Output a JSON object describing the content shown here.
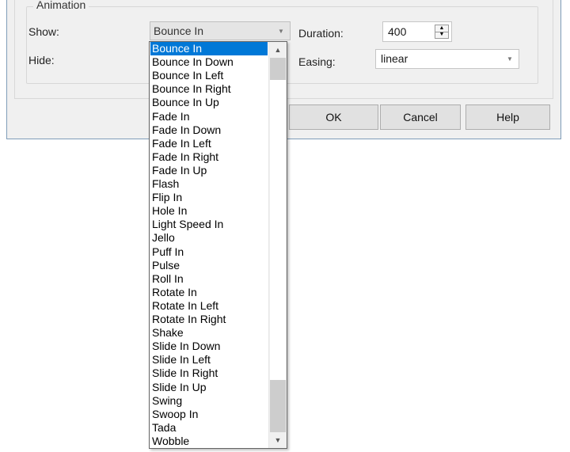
{
  "animation": {
    "group_title": "Animation",
    "show_label": "Show:",
    "hide_label": "Hide:",
    "duration_label": "Duration:",
    "easing_label": "Easing:",
    "show_value": "Bounce In",
    "duration_value": "400",
    "easing_value": "linear"
  },
  "buttons": {
    "ok": "OK",
    "cancel": "Cancel",
    "help": "Help"
  },
  "dropdown": {
    "selected": "Bounce In",
    "options": [
      "Bounce In",
      "Bounce In Down",
      "Bounce In Left",
      "Bounce In Right",
      "Bounce In Up",
      "Fade In",
      "Fade In Down",
      "Fade In Left",
      "Fade In Right",
      "Fade In Up",
      "Flash",
      "Flip In",
      "Hole In",
      "Light Speed In",
      "Jello",
      "Puff In",
      "Pulse",
      "Roll In",
      "Rotate In",
      "Rotate In Left",
      "Rotate In Right",
      "Shake",
      "Slide In Down",
      "Slide In Left",
      "Slide In Right",
      "Slide In Up",
      "Swing",
      "Swoop In",
      "Tada",
      "Wobble"
    ]
  },
  "icons": {
    "combo_arrow": "chevron-down-icon",
    "spin_up": "spin-up-icon",
    "spin_down": "spin-down-icon",
    "scroll_up": "scroll-up-icon",
    "scroll_down": "scroll-down-icon"
  },
  "colors": {
    "selection": "#0078d7",
    "dialog_bg": "#f0f0f0",
    "dialog_border": "#7f9db9"
  }
}
